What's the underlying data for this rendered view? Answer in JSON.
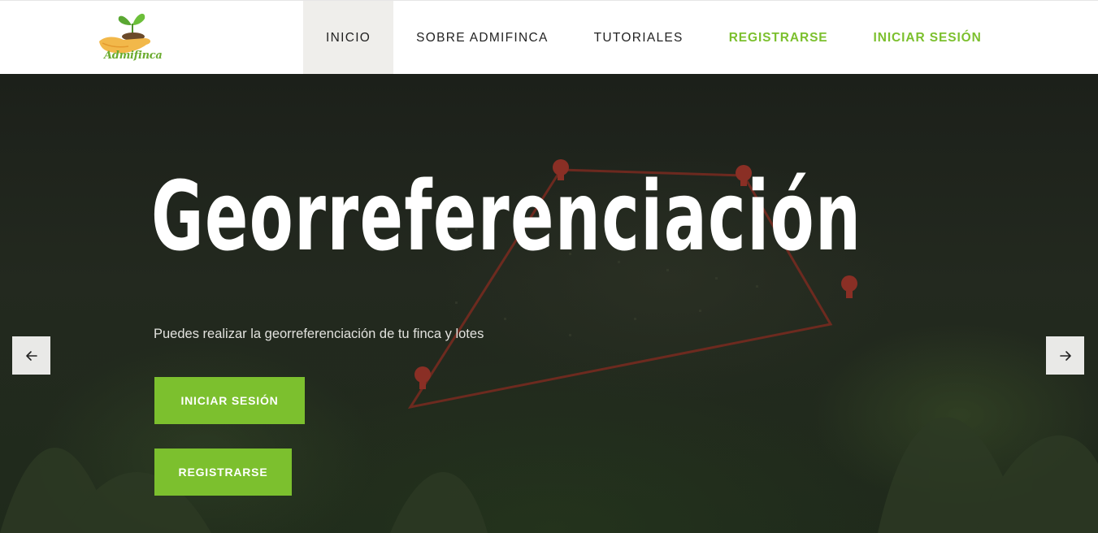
{
  "header": {
    "logo_text": "Admifinca",
    "nav": [
      {
        "label": "INICIO",
        "name": "nav-inicio"
      },
      {
        "label": "SOBRE ADMIFINCA",
        "name": "nav-sobre-admifinca"
      },
      {
        "label": "TUTORIALES",
        "name": "nav-tutoriales"
      },
      {
        "label": "REGISTRARSE",
        "name": "nav-registrarse"
      },
      {
        "label": "INICIAR SESIÓN",
        "name": "nav-iniciar-sesion"
      }
    ]
  },
  "hero": {
    "title": "Georreferenciación",
    "subtitle": "Puedes realizar la georreferenciación de tu finca y lotes",
    "login_button": "INICIAR SESIÓN",
    "register_button": "REGISTRARSE"
  },
  "icons": {
    "prev": "arrow-left-icon",
    "next": "arrow-right-icon"
  },
  "colors": {
    "accent": "#7cc02e",
    "active_nav_bg": "#efeeeb",
    "hero_bg": "#1f241c"
  }
}
